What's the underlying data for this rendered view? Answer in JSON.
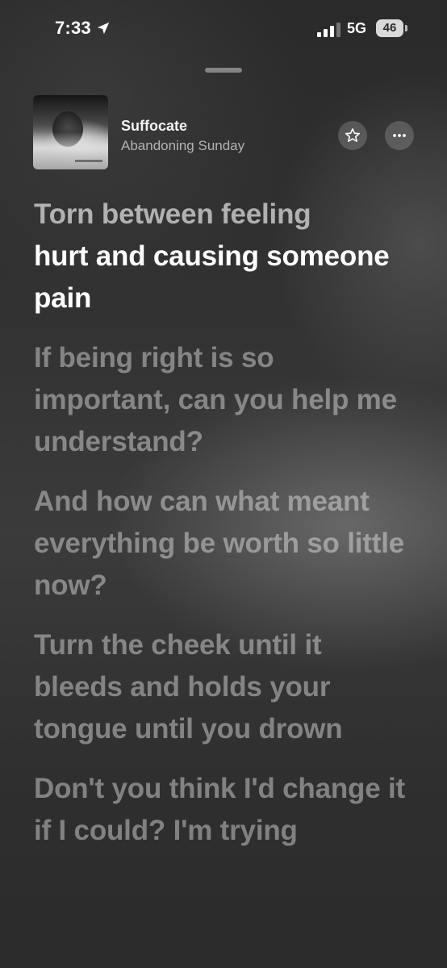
{
  "status_bar": {
    "time": "7:33",
    "network": "5G",
    "battery": "46"
  },
  "now_playing": {
    "title": "Suffocate",
    "artist": "Abandoning Sunday"
  },
  "icons": {
    "location": "location-arrow-icon",
    "signal": "cellular-signal-icon",
    "battery": "battery-icon",
    "favorite": "star-icon",
    "more": "ellipsis-icon"
  },
  "lyrics": {
    "active_line": {
      "sung": "Torn between feeling",
      "rest": "hurt and causing someone pain"
    },
    "lines": [
      "If being right is so important, can you help me understand?",
      "And how can what meant everything be worth so little now?",
      "Turn the cheek until it bleeds and holds your tongue until you drown",
      "Don't you think I'd change it if I could? I'm trying"
    ]
  },
  "colors": {
    "active_lyric": "#ffffff",
    "inactive_lyric": "rgba(255,255,255,0.4)"
  }
}
